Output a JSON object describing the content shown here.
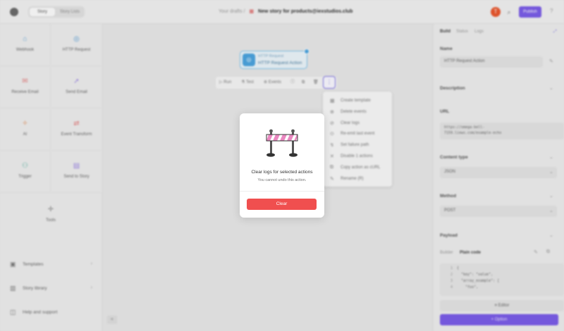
{
  "header": {
    "tabs": [
      "Story",
      "Story Lists"
    ],
    "breadcrumb_parent": "Your drafts",
    "breadcrumb_sep": "/",
    "calendar_icon": "calendar-icon",
    "story_title": "New story for products@iexstudios.club",
    "avatar_initial": "T",
    "publish_label": "Publish",
    "accent_color": "#7a5ce6"
  },
  "sidebar": {
    "agents": [
      {
        "label": "Webhook",
        "icon": "webhook-icon",
        "color": "#5a9fd4"
      },
      {
        "label": "HTTP Request",
        "icon": "http-request-icon",
        "color": "#5a9fd4"
      },
      {
        "label": "Receive Email",
        "icon": "email-icon",
        "color": "#e07a7a"
      },
      {
        "label": "Send Email",
        "icon": "send-email-icon",
        "color": "#9a86e0"
      },
      {
        "label": "AI",
        "icon": "ai-icon",
        "color": "#e08a55"
      },
      {
        "label": "Event Transform",
        "icon": "transform-icon",
        "color": "#e07a7a"
      },
      {
        "label": "Trigger",
        "icon": "trigger-icon",
        "color": "#5ab0a0"
      },
      {
        "label": "Send to Story",
        "icon": "send-to-story-icon",
        "color": "#9a86e0"
      },
      {
        "label": "Tools",
        "icon": "tools-icon",
        "color": "#888888"
      }
    ],
    "nav": [
      {
        "label": "Templates",
        "icon": "templates-icon"
      },
      {
        "label": "Story library",
        "icon": "library-icon"
      },
      {
        "label": "Help and support",
        "icon": "help-icon"
      }
    ]
  },
  "canvas": {
    "node": {
      "type_label": "HTTP Request",
      "name": "HTTP Request Action"
    },
    "action_bar": {
      "run": "Run",
      "test": "Test",
      "events": "Events"
    },
    "menu_items": [
      {
        "label": "Create template",
        "icon": "template-icon"
      },
      {
        "label": "Delete events",
        "icon": "delete-events-icon"
      },
      {
        "label": "Clear logs",
        "icon": "clear-logs-icon"
      },
      {
        "label": "Re-emit last event",
        "icon": "re-emit-icon"
      },
      {
        "label": "Set failure path",
        "icon": "failure-path-icon"
      },
      {
        "label": "Disable 1 actions",
        "icon": "disable-icon"
      },
      {
        "label": "Copy action as cURL",
        "icon": "copy-curl-icon"
      },
      {
        "label": "Rename (R)",
        "icon": "rename-icon"
      }
    ]
  },
  "modal": {
    "title": "Clear logs for selected actions",
    "subtitle": "You cannot undo this action.",
    "confirm_label": "Clear",
    "confirm_color": "#f04f4f"
  },
  "panel": {
    "tabs": [
      "Build",
      "Status",
      "Logs"
    ],
    "name_label": "Name",
    "name_value": "HTTP Request Action",
    "description_label": "Description",
    "url_label": "URL",
    "url_lines": [
      "https://omega-bell-",
      "7159.liews.com/example-echo"
    ],
    "content_type_label": "Content type",
    "content_type_value": "JSON",
    "method_label": "Method",
    "method_value": "POST",
    "payload_label": "Payload",
    "payload_tabs": [
      "Builder",
      "Plain code"
    ],
    "code_lines": [
      {
        "num": "1",
        "text": "{"
      },
      {
        "num": "2",
        "text": "  \"key\": \"value\","
      },
      {
        "num": "3",
        "text": "  \"array_example\": ["
      },
      {
        "num": "4",
        "text": "    \"foo\","
      }
    ],
    "editor_label": "Editor",
    "option_label": "Option"
  }
}
